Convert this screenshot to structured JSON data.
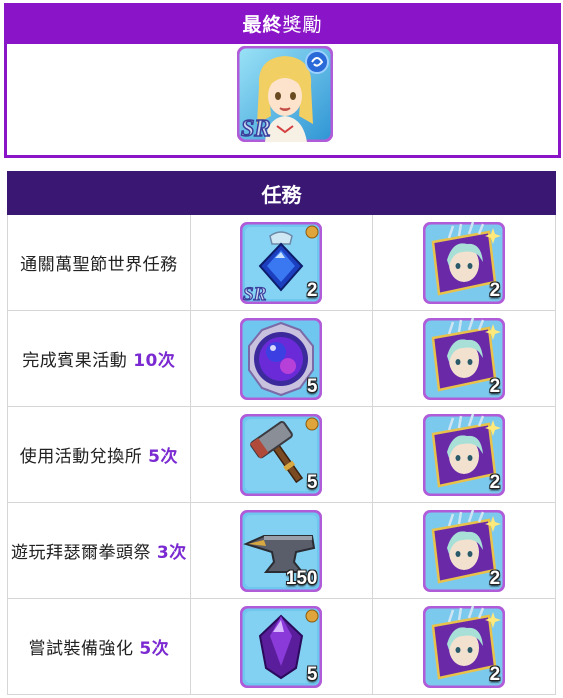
{
  "final_reward": {
    "title_bold": "最終",
    "title_light": "獎勵"
  },
  "missions": {
    "header": "任務",
    "rows": [
      {
        "text": "通關萬聖節世界任務",
        "count": "",
        "reward1_qty": "2",
        "reward2_qty": "2"
      },
      {
        "text": "完成賓果活動 ",
        "count": "10次",
        "reward1_qty": "5",
        "reward2_qty": "2"
      },
      {
        "text": "使用活動兌換所 ",
        "count": "5次",
        "reward1_qty": "5",
        "reward2_qty": "2"
      },
      {
        "text": "遊玩拜瑟爾拳頭祭 ",
        "count": "3次",
        "reward1_qty": "150",
        "reward2_qty": "2"
      },
      {
        "text": "嘗試裝備強化 ",
        "count": "5次",
        "reward1_qty": "5",
        "reward2_qty": "2"
      }
    ]
  },
  "icons": {
    "final": "sr-character-card-icon",
    "row_rewards": [
      "sr-blue-gem-amulet-icon",
      "purple-orb-icon",
      "forge-hammer-icon",
      "anvil-icon",
      "purple-crystal-icon"
    ],
    "common_reward": "character-portrait-ticket-icon"
  },
  "colors": {
    "final_header": "#8a14c7",
    "table_header": "#3b1774",
    "count_text": "#7a2ad0",
    "icon_border": "#b05cd8"
  }
}
